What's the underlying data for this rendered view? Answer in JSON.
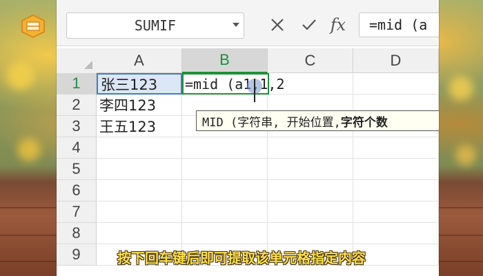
{
  "toolbar": {
    "name_box": "SUMIF",
    "cancel_icon": "×",
    "enter_icon": "✓",
    "fx_icon": "fx",
    "formula_text": "=mid (a"
  },
  "grid": {
    "columns": [
      "A",
      "B",
      "C",
      "D"
    ],
    "rows": [
      "1",
      "2",
      "3",
      "4",
      "5",
      "6",
      "7",
      "8",
      "9"
    ],
    "cells": {
      "A1": "张三123",
      "A2": "李四123",
      "A3": "王五123",
      "B1": "=mid (a1,1,2"
    }
  },
  "tooltip": {
    "normal": "MID (字符串, 开始位置, ",
    "bold": "字符个数"
  },
  "caption": "按下回车键后即可提取该单元格指定内容",
  "colors": {
    "active_green": "#1e8f3c",
    "selection_blue": "#4a78c2",
    "caption_yellow": "#ffe04a"
  }
}
